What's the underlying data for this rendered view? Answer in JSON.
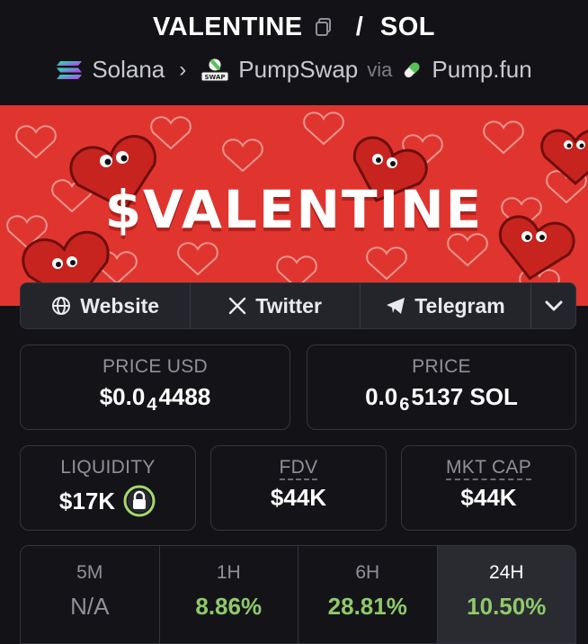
{
  "header": {
    "token": "VALENTINE",
    "separator": "/",
    "quote": "SOL",
    "chain": "Solana",
    "dex": "PumpSwap",
    "via": "via",
    "launchpad": "Pump.fun"
  },
  "banner": {
    "text": "$VALENTINE",
    "bg_color": "#e0352f"
  },
  "social": {
    "website": "Website",
    "twitter": "Twitter",
    "telegram": "Telegram"
  },
  "stats": {
    "price_usd_label": "PRICE USD",
    "price_usd_prefix": "$0.0",
    "price_usd_zeros": "4",
    "price_usd_digits": "4488",
    "price_label": "PRICE",
    "price_prefix": "0.0",
    "price_zeros": "6",
    "price_digits": "5137 SOL",
    "liquidity_label": "LIQUIDITY",
    "liquidity_value": "$17K",
    "fdv_label": "FDV",
    "fdv_value": "$44K",
    "mktcap_label": "MKT CAP",
    "mktcap_value": "$44K"
  },
  "timeframes": [
    {
      "label": "5M",
      "value": "N/A"
    },
    {
      "label": "1H",
      "value": "8.86%"
    },
    {
      "label": "6H",
      "value": "28.81%"
    },
    {
      "label": "24H",
      "value": "10.50%"
    }
  ],
  "colors": {
    "positive": "#8fc96a",
    "lock_ring": "#a6d86b"
  }
}
